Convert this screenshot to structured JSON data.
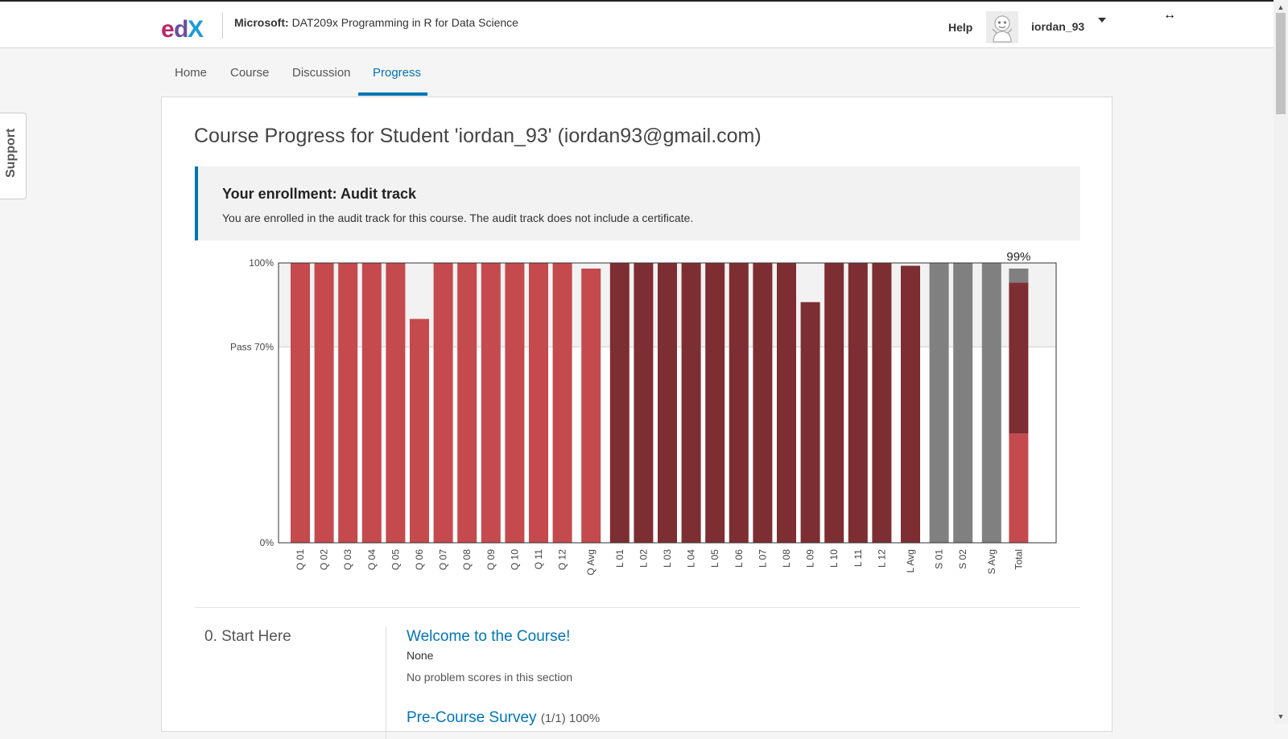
{
  "header": {
    "course_org": "Microsoft:",
    "course_name": "DAT209x Programming in R for Data Science",
    "help_label": "Help",
    "username": "iordan_93"
  },
  "support_tab": {
    "label": "Support"
  },
  "nav": {
    "tabs": [
      "Home",
      "Course",
      "Discussion",
      "Progress"
    ],
    "active": "Progress"
  },
  "progress": {
    "title": "Course Progress for Student 'iordan_93' (iordan93@gmail.com)",
    "enrollment_heading": "Your enrollment: Audit track",
    "enrollment_text": "You are enrolled in the audit track for this course. The audit track does not include a certificate."
  },
  "colors": {
    "quiz": "#c44a4e",
    "lab": "#7d2e33",
    "survey": "#808080",
    "link": "#0075b4"
  },
  "chart_data": {
    "type": "bar",
    "y_ticks": [
      "100%",
      "Pass 70%",
      "0%"
    ],
    "ylim": [
      0,
      100
    ],
    "pass_threshold": 70,
    "total_label": "99%",
    "bars": [
      {
        "label": "Q 01",
        "value": 100,
        "group": "quiz"
      },
      {
        "label": "Q 02",
        "value": 100,
        "group": "quiz"
      },
      {
        "label": "Q 03",
        "value": 100,
        "group": "quiz"
      },
      {
        "label": "Q 04",
        "value": 100,
        "group": "quiz"
      },
      {
        "label": "Q 05",
        "value": 100,
        "group": "quiz"
      },
      {
        "label": "Q 06",
        "value": 80,
        "group": "quiz"
      },
      {
        "label": "Q 07",
        "value": 100,
        "group": "quiz"
      },
      {
        "label": "Q 08",
        "value": 100,
        "group": "quiz"
      },
      {
        "label": "Q 09",
        "value": 100,
        "group": "quiz"
      },
      {
        "label": "Q 10",
        "value": 100,
        "group": "quiz"
      },
      {
        "label": "Q 11",
        "value": 100,
        "group": "quiz"
      },
      {
        "label": "Q 12",
        "value": 100,
        "group": "quiz"
      },
      {
        "label": "Q Avg",
        "value": 98,
        "group": "quiz",
        "avg": true
      },
      {
        "label": "L 01",
        "value": 100,
        "group": "lab"
      },
      {
        "label": "L 02",
        "value": 100,
        "group": "lab"
      },
      {
        "label": "L 03",
        "value": 100,
        "group": "lab"
      },
      {
        "label": "L 04",
        "value": 100,
        "group": "lab"
      },
      {
        "label": "L 05",
        "value": 100,
        "group": "lab"
      },
      {
        "label": "L 06",
        "value": 100,
        "group": "lab"
      },
      {
        "label": "L 07",
        "value": 100,
        "group": "lab"
      },
      {
        "label": "L 08",
        "value": 100,
        "group": "lab"
      },
      {
        "label": "L 09",
        "value": 86,
        "group": "lab"
      },
      {
        "label": "L 10",
        "value": 100,
        "group": "lab"
      },
      {
        "label": "L 11",
        "value": 100,
        "group": "lab"
      },
      {
        "label": "L 12",
        "value": 100,
        "group": "lab"
      },
      {
        "label": "L Avg",
        "value": 99,
        "group": "lab",
        "avg": true
      },
      {
        "label": "S 01",
        "value": 100,
        "group": "survey"
      },
      {
        "label": "S 02",
        "value": 100,
        "group": "survey"
      },
      {
        "label": "S Avg",
        "value": 100,
        "group": "survey",
        "avg": true
      }
    ],
    "total": {
      "label": "Total",
      "segments": [
        {
          "group": "quiz",
          "value": 39
        },
        {
          "group": "lab",
          "value": 54
        },
        {
          "group": "survey",
          "value": 5
        }
      ]
    }
  },
  "sections": [
    {
      "name": "0. Start Here",
      "subsections": [
        {
          "title": "Welcome to the Course!",
          "due": "None",
          "note": "No problem scores in this section"
        },
        {
          "title": "Pre-Course Survey",
          "score": "(1/1) 100%"
        }
      ]
    }
  ]
}
